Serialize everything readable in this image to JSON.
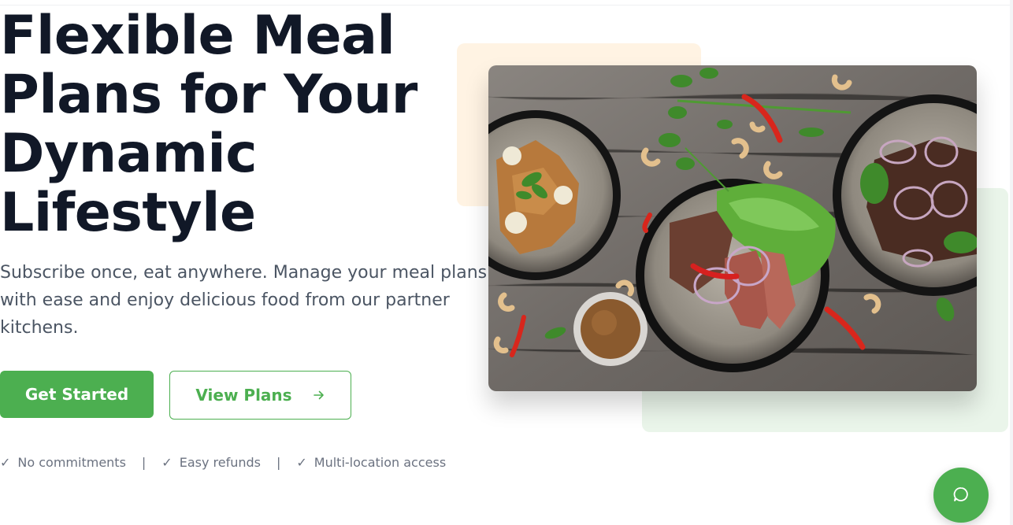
{
  "hero": {
    "title_lines": [
      "Flexible Meal",
      "Plans for Your",
      "Dynamic",
      "Lifestyle"
    ],
    "subtitle_lines": [
      "Subscribe once, eat anywhere. Manage your meal plans",
      "with ease and enjoy delicious food from our partner",
      "kitchens."
    ],
    "primary_button": "Get Started",
    "secondary_button": "View Plans",
    "secondary_button_icon": "arrow-right-icon"
  },
  "features": {
    "check_glyph": "✓",
    "separator": "|",
    "items": [
      "No commitments",
      "Easy refunds",
      "Multi-location access"
    ]
  },
  "image": {
    "alt": "Bowls of grilled steak salad with herbs, chili peppers, cashews and dipping sauce on a wooden table"
  },
  "chat": {
    "icon": "chat-bubble-icon"
  },
  "colors": {
    "brand_green": "#4caf50",
    "heading": "#111827",
    "body_text": "#4b5563",
    "muted_text": "#6b7280",
    "accent_peach": "#fff3e3",
    "accent_green_light": "#eaf5ea"
  }
}
